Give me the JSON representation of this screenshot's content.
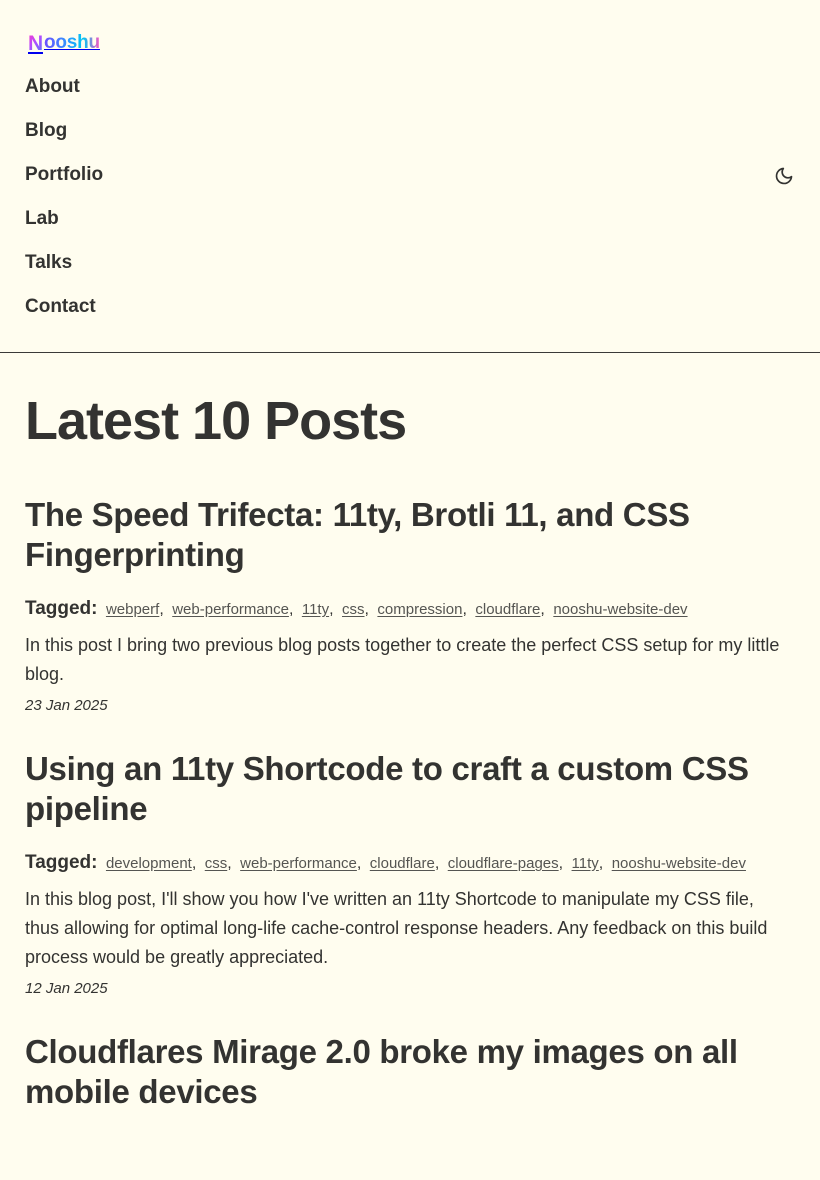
{
  "site": {
    "logo_initial": "N",
    "logo_text": "ooshu",
    "nav": [
      {
        "label": "About"
      },
      {
        "label": "Blog"
      },
      {
        "label": "Portfolio"
      },
      {
        "label": "Lab"
      },
      {
        "label": "Talks"
      },
      {
        "label": "Contact"
      }
    ],
    "theme_toggle_icon": "moon-icon"
  },
  "main": {
    "page_title": "Latest 10 Posts",
    "tagged_label": "Tagged:",
    "posts": [
      {
        "title": "The Speed Trifecta: 11ty, Brotli 11, and CSS Fingerprinting",
        "tags": [
          "webperf",
          "web-performance",
          "11ty",
          "css",
          "compression",
          "cloudflare",
          "nooshu-website-dev"
        ],
        "excerpt": "In this post I bring two previous blog posts together to create the perfect CSS setup for my little blog.",
        "date": "23 Jan 2025"
      },
      {
        "title": "Using an 11ty Shortcode to craft a custom CSS pipeline",
        "tags": [
          "development",
          "css",
          "web-performance",
          "cloudflare",
          "cloudflare-pages",
          "11ty",
          "nooshu-website-dev"
        ],
        "excerpt": "In this blog post, I'll show you how I've written an 11ty Shortcode to manipulate my CSS file, thus allowing for optimal long-life cache-control response headers. Any feedback on this build process would be greatly appreciated.",
        "date": "12 Jan 2025"
      },
      {
        "title": "Cloudflares Mirage 2.0 broke my images on all mobile devices"
      }
    ]
  },
  "colors": {
    "background": "#fffdef",
    "text": "#333331",
    "logo_gradient": [
      "#6f4dff",
      "#2b9cff",
      "#00c6f2",
      "#ff4fc2"
    ]
  }
}
